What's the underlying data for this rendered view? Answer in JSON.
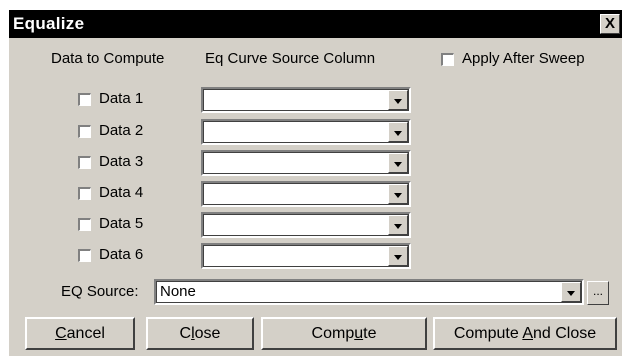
{
  "window": {
    "title": "Equalize",
    "close_glyph": "X"
  },
  "headers": {
    "data_to_compute": "Data to Compute",
    "eq_curve_source_column": "Eq Curve Source Column"
  },
  "apply_after_sweep": {
    "label": "Apply After Sweep",
    "checked": false
  },
  "rows": [
    {
      "label": "Data 1",
      "checked": false,
      "column_value": ""
    },
    {
      "label": "Data 2",
      "checked": false,
      "column_value": ""
    },
    {
      "label": "Data 3",
      "checked": false,
      "column_value": ""
    },
    {
      "label": "Data 4",
      "checked": false,
      "column_value": ""
    },
    {
      "label": "Data 5",
      "checked": false,
      "column_value": ""
    },
    {
      "label": "Data 6",
      "checked": false,
      "column_value": ""
    }
  ],
  "eq_source": {
    "label": "EQ Source:",
    "value": "None",
    "browse_label": "..."
  },
  "buttons": {
    "cancel": {
      "label": "Cancel",
      "mnemonic_index": 0
    },
    "close": {
      "label": "Close",
      "mnemonic_index": 1
    },
    "compute": {
      "label": "Compute",
      "mnemonic_index": 4
    },
    "compute_and_close": {
      "label": "Compute And Close",
      "mnemonic_index": 8
    }
  }
}
